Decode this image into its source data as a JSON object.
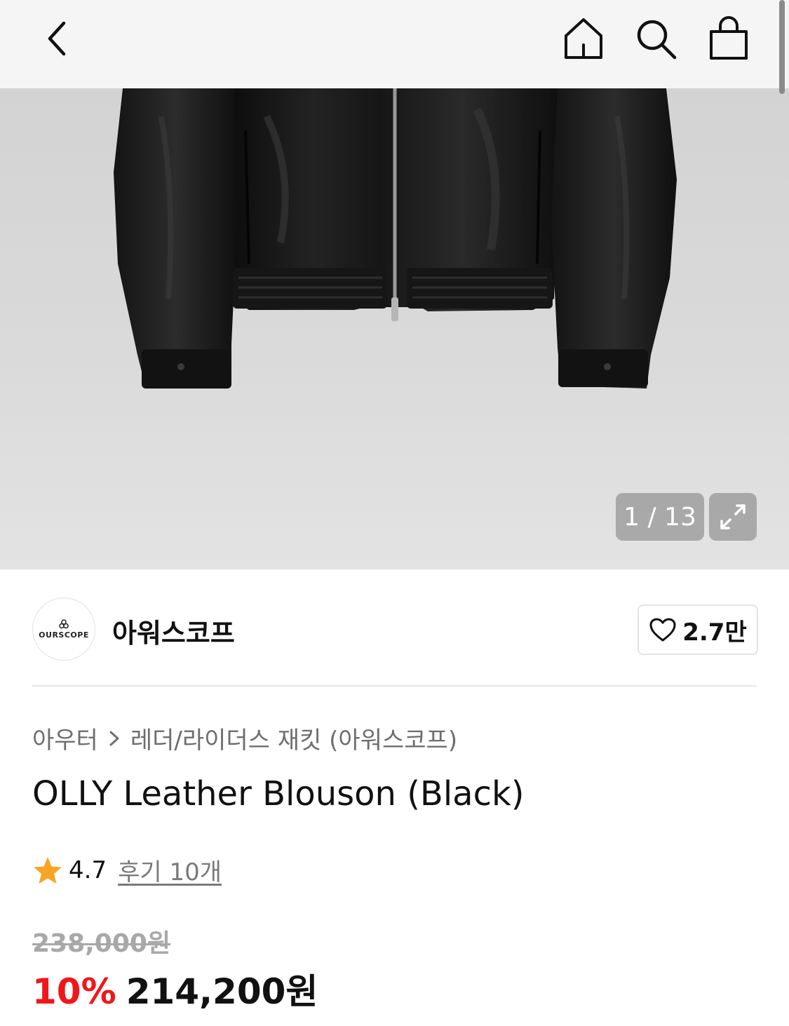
{
  "topbar": {
    "back_icon": "chevron-left-icon",
    "home_icon": "home-icon",
    "search_icon": "search-icon",
    "bag_icon": "shopping-bag-icon"
  },
  "gallery": {
    "counter": "1 / 13",
    "expand_icon": "expand-icon",
    "image_subject": "black leather jacket"
  },
  "brand": {
    "logo_text": "OURSCOPE",
    "name": "아워스코프",
    "likes": "2.7만",
    "heart_icon": "heart-icon"
  },
  "breadcrumb": {
    "items": [
      "아우터",
      "레더/라이더스 재킷 (아워스코프)"
    ]
  },
  "product": {
    "title": "OLLY Leather Blouson (Black)",
    "rating": "4.7",
    "reviews": "후기 10개",
    "original_price": "238,000원",
    "discount": "10%",
    "price": "214,200원"
  },
  "colors": {
    "discount": "#f0171a",
    "star": "#f6a623",
    "topbar_bg": "#f5f5f5"
  }
}
